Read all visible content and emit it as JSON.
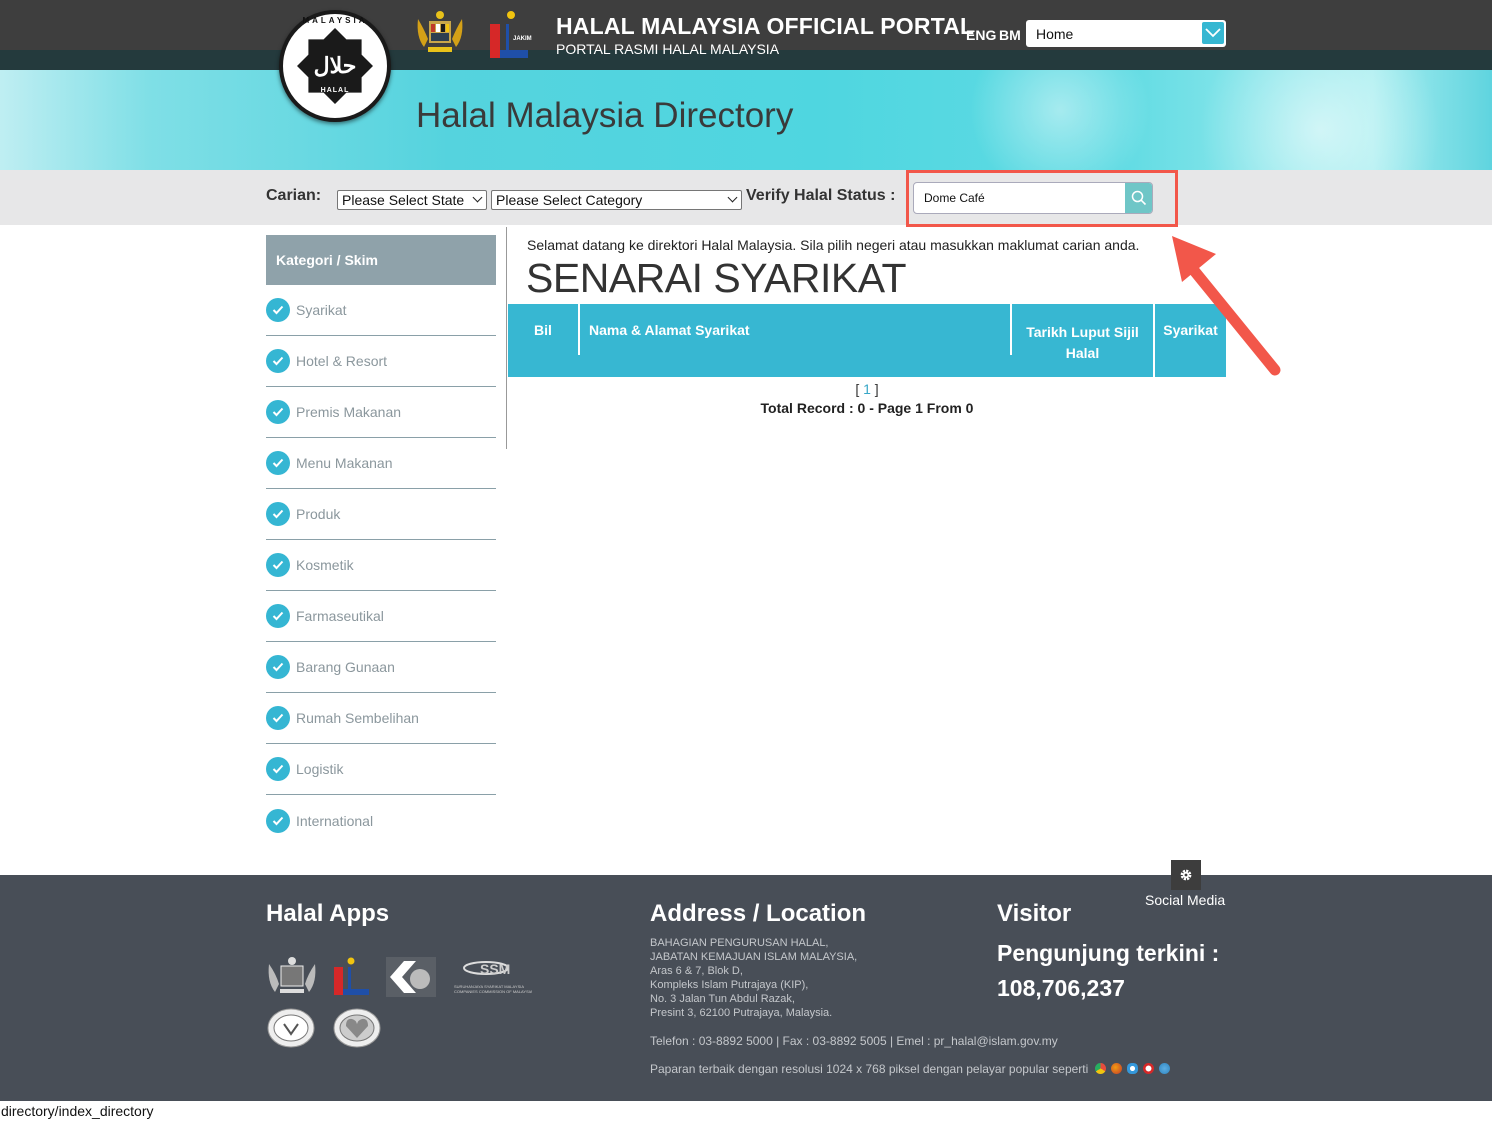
{
  "header": {
    "portal_title": "HALAL MALAYSIA OFFICIAL PORTAL",
    "portal_subtitle": "PORTAL RASMI HALAL MALAYSIA",
    "halal_logo": {
      "ring_text": "MALAYSIA",
      "center_text": "حلال",
      "sub_text": "HALAL"
    },
    "jakim_logo_text": "JAKIM",
    "lang_eng": "ENG",
    "lang_bm": "BM",
    "nav_select_value": "Home",
    "directory_title": "Halal Malaysia Directory"
  },
  "search": {
    "label": "Carian:",
    "state_select": "Please Select State",
    "category_select": "Please Select Category",
    "verify_label": "Verify Halal Status :",
    "verify_value": "Dome Café",
    "highlight_color": "#f2574a"
  },
  "sidebar": {
    "heading": "Kategori / Skim",
    "items": [
      {
        "label": "Syarikat"
      },
      {
        "label": "Hotel & Resort"
      },
      {
        "label": "Premis Makanan"
      },
      {
        "label": "Menu Makanan"
      },
      {
        "label": "Produk"
      },
      {
        "label": "Kosmetik"
      },
      {
        "label": "Farmaseutikal"
      },
      {
        "label": "Barang Gunaan"
      },
      {
        "label": "Rumah Sembelihan"
      },
      {
        "label": "Logistik"
      },
      {
        "label": "International"
      }
    ]
  },
  "main": {
    "welcome": "Selamat datang ke direktori Halal Malaysia. Sila pilih negeri atau masukkan maklumat carian anda.",
    "title": "SENARAI SYARIKAT",
    "columns": [
      "Bil",
      "Nama & Alamat Syarikat",
      "Tarikh Luput Sijil Halal",
      "Syarikat"
    ],
    "rows": [],
    "pager_open": "[",
    "pager_page": "1",
    "pager_close": "]",
    "total_record": "Total Record : 0 - Page 1 From 0",
    "accent_color": "#37b7d2"
  },
  "footer": {
    "social_media": "Social Media",
    "apps_heading": "Halal Apps",
    "apps": [
      {
        "name": "Malaysia Government Crest"
      },
      {
        "name": "JAKIM"
      },
      {
        "name": "KPDNHEP"
      },
      {
        "name": "SSM",
        "caption": "SURUHANJAYA SYARIKAT MALAYSIA COMPANIES COMMISSION OF MALAYSIA"
      },
      {
        "name": "Veterinary Services Malaysia"
      },
      {
        "name": "Consumer Association"
      }
    ],
    "address_heading": "Address / Location",
    "address": "BAHAGIAN PENGURUSAN HALAL,\nJABATAN KEMAJUAN ISLAM MALAYSIA,\nAras 6 & 7, Blok D,\nKompleks Islam Putrajaya (KIP),\nNo. 3 Jalan Tun Abdul Razak,\nPresint 3, 62100 Putrajaya, Malaysia.",
    "contact": "Telefon : 03-8892 5000 | Fax : 03-8892 5005 | Emel : pr_halal@islam.gov.my",
    "best_view": "Paparan terbaik dengan resolusi 1024 x 768 piksel dengan pelayar popular seperti",
    "browsers": [
      "chrome-icon",
      "firefox-icon",
      "ie-icon",
      "opera-icon",
      "safari-icon"
    ],
    "visitor_heading": "Visitor",
    "visitor_label": "Pengunjung terkini :",
    "visitor_count": "108,706,237"
  },
  "statusbar": {
    "url": "directory/index_directory"
  }
}
